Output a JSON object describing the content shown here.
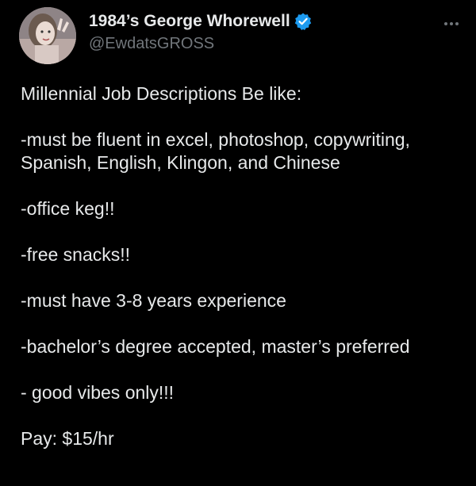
{
  "author": {
    "display_name": "1984’s George Whorewell",
    "handle": "@EwdatsGROSS",
    "verified": true,
    "avatar_icon": "profile-photo"
  },
  "menu": {
    "more_icon": "more-horizontal-icon"
  },
  "tweet": {
    "paragraphs": [
      "Millennial Job Descriptions Be like:",
      "-must be fluent in excel, photoshop, copywriting, Spanish, English, Klingon, and Chinese",
      "-office keg!!",
      "-free snacks!!",
      "-must have 3-8 years experience",
      "-bachelor’s degree accepted, master’s preferred",
      "- good vibes only!!!",
      "Pay: $15/hr"
    ]
  },
  "colors": {
    "background": "#000000",
    "text": "#e7e9ea",
    "secondary_text": "#71767b",
    "verified_badge": "#1d9bf0"
  }
}
